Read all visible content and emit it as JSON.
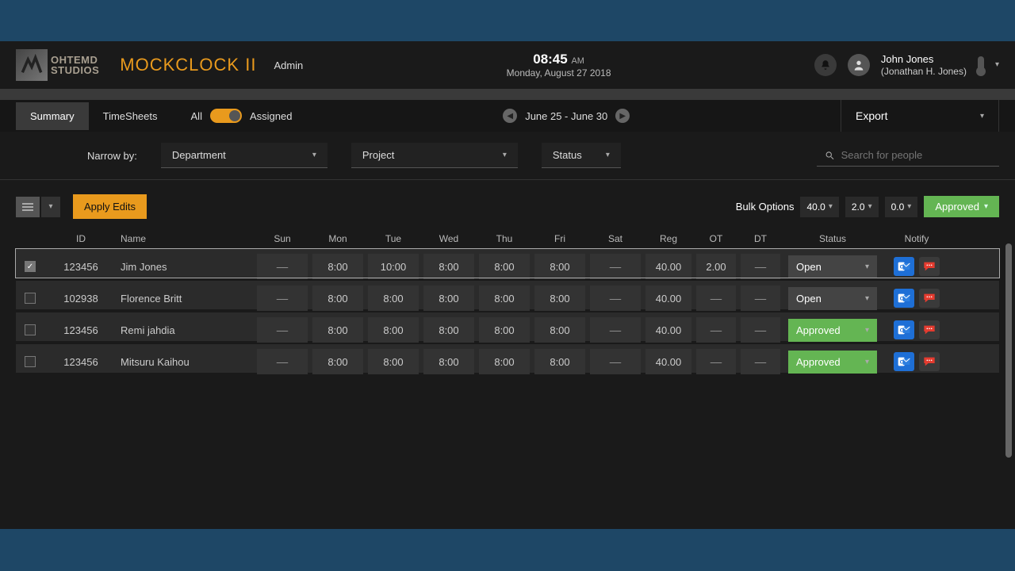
{
  "header": {
    "studio_top": "OHTEMD",
    "studio_bottom": "STUDIOS",
    "app_title": "MOCKCLOCK II",
    "role": "Admin",
    "time": "08:45",
    "time_suffix": "AM",
    "date": "Monday, August 27 2018",
    "user_name": "John Jones",
    "user_full": "(Jonathan H. Jones)"
  },
  "tabs": {
    "summary": "Summary",
    "timesheets": "TimeSheets",
    "toggle_all": "All",
    "toggle_assigned": "Assigned",
    "date_range": "June 25 - June 30",
    "export": "Export"
  },
  "filters": {
    "narrow": "Narrow by:",
    "department": "Department",
    "project": "Project",
    "status": "Status",
    "search_placeholder": "Search for people"
  },
  "actions": {
    "apply": "Apply Edits",
    "bulk_label": "Bulk Options",
    "bulk_reg": "40.0",
    "bulk_ot": "2.0",
    "bulk_dt": "0.0",
    "bulk_approved": "Approved"
  },
  "columns": {
    "id": "ID",
    "name": "Name",
    "sun": "Sun",
    "mon": "Mon",
    "tue": "Tue",
    "wed": "Wed",
    "thu": "Thu",
    "fri": "Fri",
    "sat": "Sat",
    "reg": "Reg",
    "ot": "OT",
    "dt": "DT",
    "status": "Status",
    "notify": "Notify"
  },
  "status_labels": {
    "open": "Open",
    "approved": "Approved"
  },
  "rows": [
    {
      "checked": true,
      "id": "123456",
      "name": "Jim Jones",
      "sun": "––",
      "mon": "8:00",
      "tue": "10:00",
      "wed": "8:00",
      "thu": "8:00",
      "fri": "8:00",
      "sat": "––",
      "reg": "40.00",
      "ot": "2.00",
      "dt": "––",
      "status": "open"
    },
    {
      "checked": false,
      "id": "102938",
      "name": "Florence Britt",
      "sun": "––",
      "mon": "8:00",
      "tue": "8:00",
      "wed": "8:00",
      "thu": "8:00",
      "fri": "8:00",
      "sat": "––",
      "reg": "40.00",
      "ot": "––",
      "dt": "––",
      "status": "open"
    },
    {
      "checked": false,
      "id": "123456",
      "name": "Remi jahdia",
      "sun": "––",
      "mon": "8:00",
      "tue": "8:00",
      "wed": "8:00",
      "thu": "8:00",
      "fri": "8:00",
      "sat": "––",
      "reg": "40.00",
      "ot": "––",
      "dt": "––",
      "status": "approved"
    },
    {
      "checked": false,
      "id": "123456",
      "name": "Mitsuru Kaihou",
      "sun": "––",
      "mon": "8:00",
      "tue": "8:00",
      "wed": "8:00",
      "thu": "8:00",
      "fri": "8:00",
      "sat": "––",
      "reg": "40.00",
      "ot": "––",
      "dt": "––",
      "status": "approved"
    }
  ]
}
